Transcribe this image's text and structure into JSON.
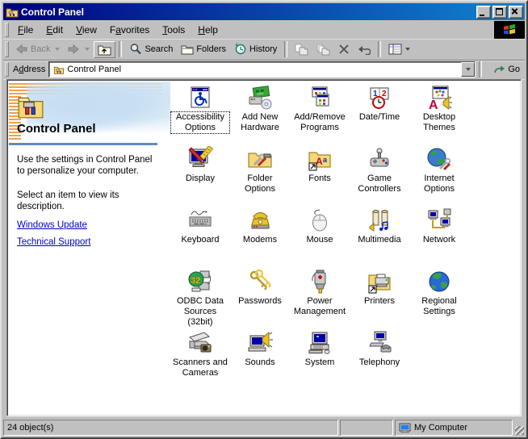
{
  "window": {
    "title": "Control Panel"
  },
  "menu": {
    "items": [
      {
        "pre": "",
        "accel": "F",
        "post": "ile"
      },
      {
        "pre": "",
        "accel": "E",
        "post": "dit"
      },
      {
        "pre": "",
        "accel": "V",
        "post": "iew"
      },
      {
        "pre": "F",
        "accel": "a",
        "post": "vorites"
      },
      {
        "pre": "",
        "accel": "T",
        "post": "ools"
      },
      {
        "pre": "",
        "accel": "H",
        "post": "elp"
      }
    ]
  },
  "toolbar": {
    "back": "Back",
    "search": "Search",
    "folders": "Folders",
    "history": "History"
  },
  "address": {
    "label": {
      "pre": "A",
      "accel": "d",
      "post": "dress"
    },
    "value": "Control Panel",
    "go": "Go"
  },
  "sidebar": {
    "title": "Control Panel",
    "paragraph1": "Use the settings in Control Panel to personalize your computer.",
    "paragraph2": "Select an item to view its description.",
    "link1": "Windows Update",
    "link2": "Technical Support"
  },
  "icons": [
    {
      "label": "Accessibility Options"
    },
    {
      "label": "Add New Hardware"
    },
    {
      "label": "Add/Remove Programs"
    },
    {
      "label": "Date/Time"
    },
    {
      "label": "Desktop Themes"
    },
    {
      "label": "Display"
    },
    {
      "label": "Folder Options"
    },
    {
      "label": "Fonts"
    },
    {
      "label": "Game Controllers"
    },
    {
      "label": "Internet Options"
    },
    {
      "label": "Keyboard"
    },
    {
      "label": "Modems"
    },
    {
      "label": "Mouse"
    },
    {
      "label": "Multimedia"
    },
    {
      "label": "Network"
    },
    {
      "label": "ODBC Data Sources (32bit)"
    },
    {
      "label": "Passwords"
    },
    {
      "label": "Power Management"
    },
    {
      "label": "Printers"
    },
    {
      "label": "Regional Settings"
    },
    {
      "label": "Scanners and Cameras"
    },
    {
      "label": "Sounds"
    },
    {
      "label": "System"
    },
    {
      "label": "Telephony"
    }
  ],
  "statusbar": {
    "objects": "24 object(s)",
    "zone": "My Computer"
  },
  "colors": {
    "titlebar_left": "#000080",
    "titlebar_right": "#1084d0",
    "link": "#0000cc",
    "rule": "#5b8cbe",
    "stripe": "#efa24c",
    "face": "#c0c0c0"
  }
}
